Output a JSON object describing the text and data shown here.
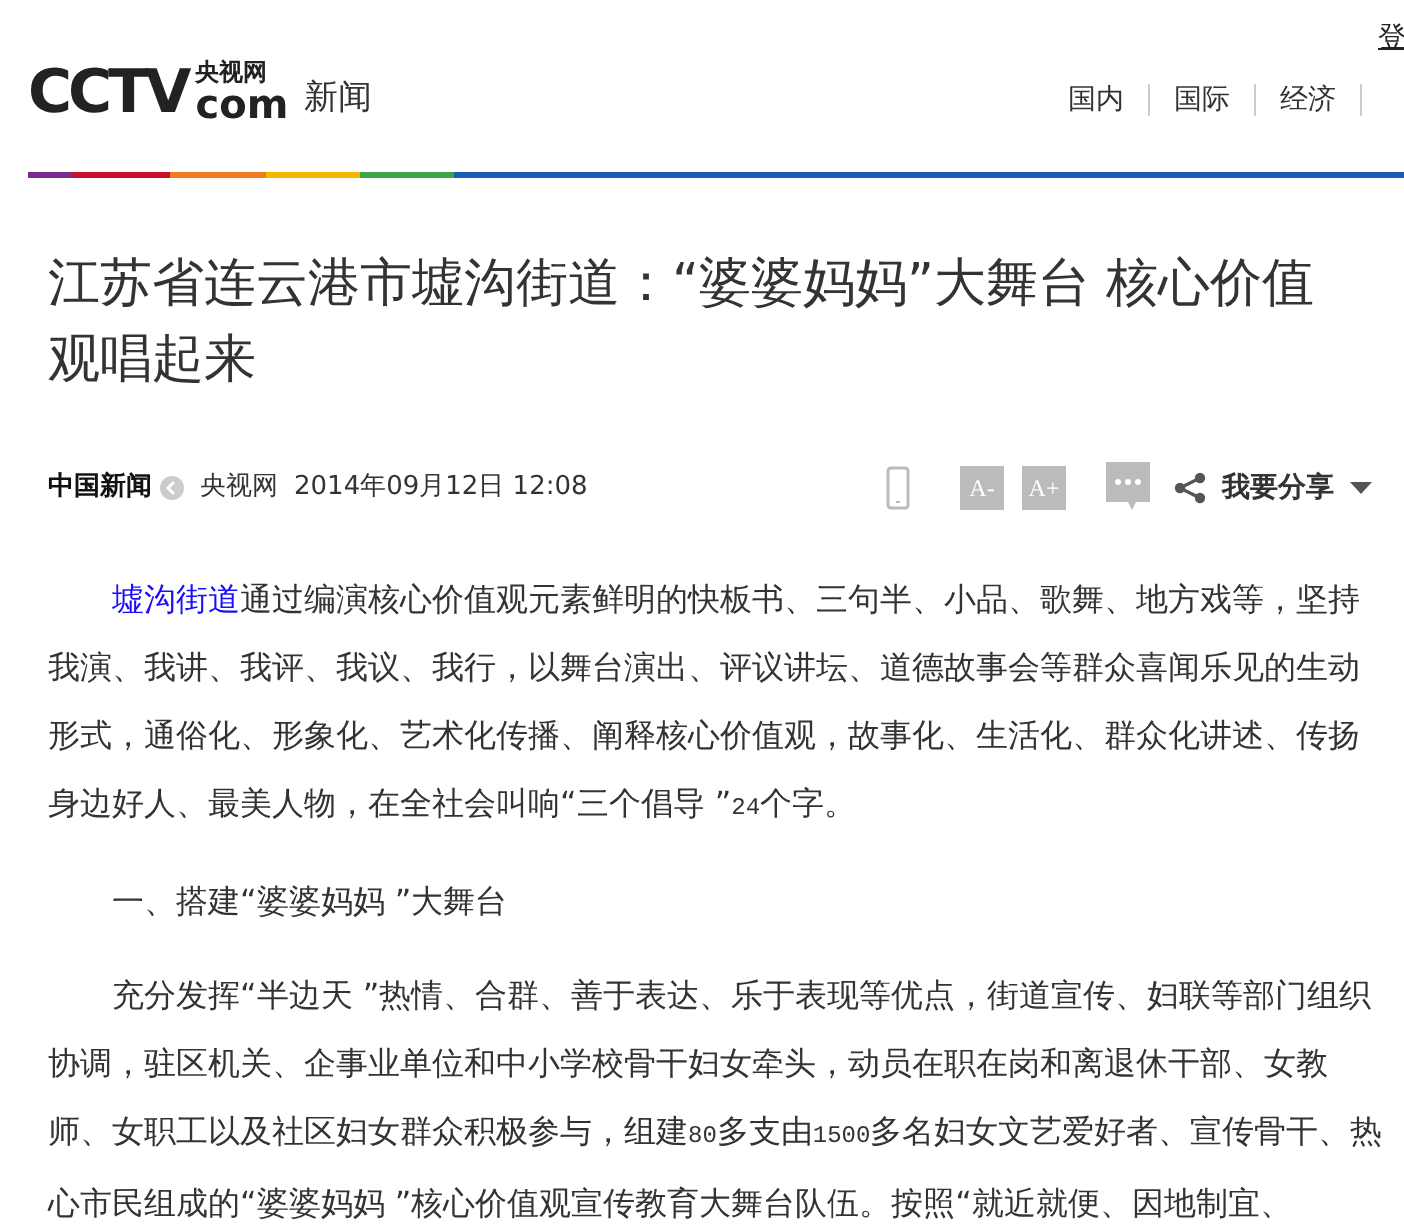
{
  "header": {
    "login": "登",
    "logo": {
      "mark": "CCTV",
      "domain": "com",
      "cn": "央视网"
    },
    "section": "新闻",
    "nav": [
      "国内",
      "国际",
      "经济"
    ]
  },
  "article": {
    "title": "江苏省连云港市墟沟街道：“婆婆妈妈”大舞台 核心价值观唱起来",
    "meta": {
      "source": "中国新闻",
      "origin": "央视网",
      "date": "2014年09月12日 12:08"
    },
    "tools": {
      "font_smaller": "A-",
      "font_larger": "A+",
      "share": "我要分享"
    },
    "body": [
      {
        "kind": "paragraph",
        "link": "墟沟街道",
        "text": "通过编演核心价值观元素鲜明的快板书、三句半、小品、歌舞、地方戏等，坚持我演、我讲、我评、我议、我行，以舞台演出、评议讲坛、道德故事会等群众喜闻乐见的生动形式，通俗化、形象化、艺术化传播、阐释核心价值观，故事化、生活化、群众化讲述、传扬身边好人、最美人物，在全社会叫响“三个倡导 ”24个字。"
      },
      {
        "kind": "heading",
        "text": "一、搭建“婆婆妈妈 ”大舞台"
      },
      {
        "kind": "paragraph",
        "text": "充分发挥“半边天 ”热情、合群、善于表达、乐于表现等优点，街道宣传、妇联等部门组织协调，驻区机关、企事业单位和中小学校骨干妇女牵头，动员在职在岗和离退休干部、女教师、女职工以及社区妇女群众积极参与，组建80多支由1500多名妇女文艺爱好者、宣传骨干、热心市民组成的“婆婆妈妈 ”核心价值观宣传教育大舞台队伍。按照“就近就便、因地制宜、"
      }
    ]
  }
}
